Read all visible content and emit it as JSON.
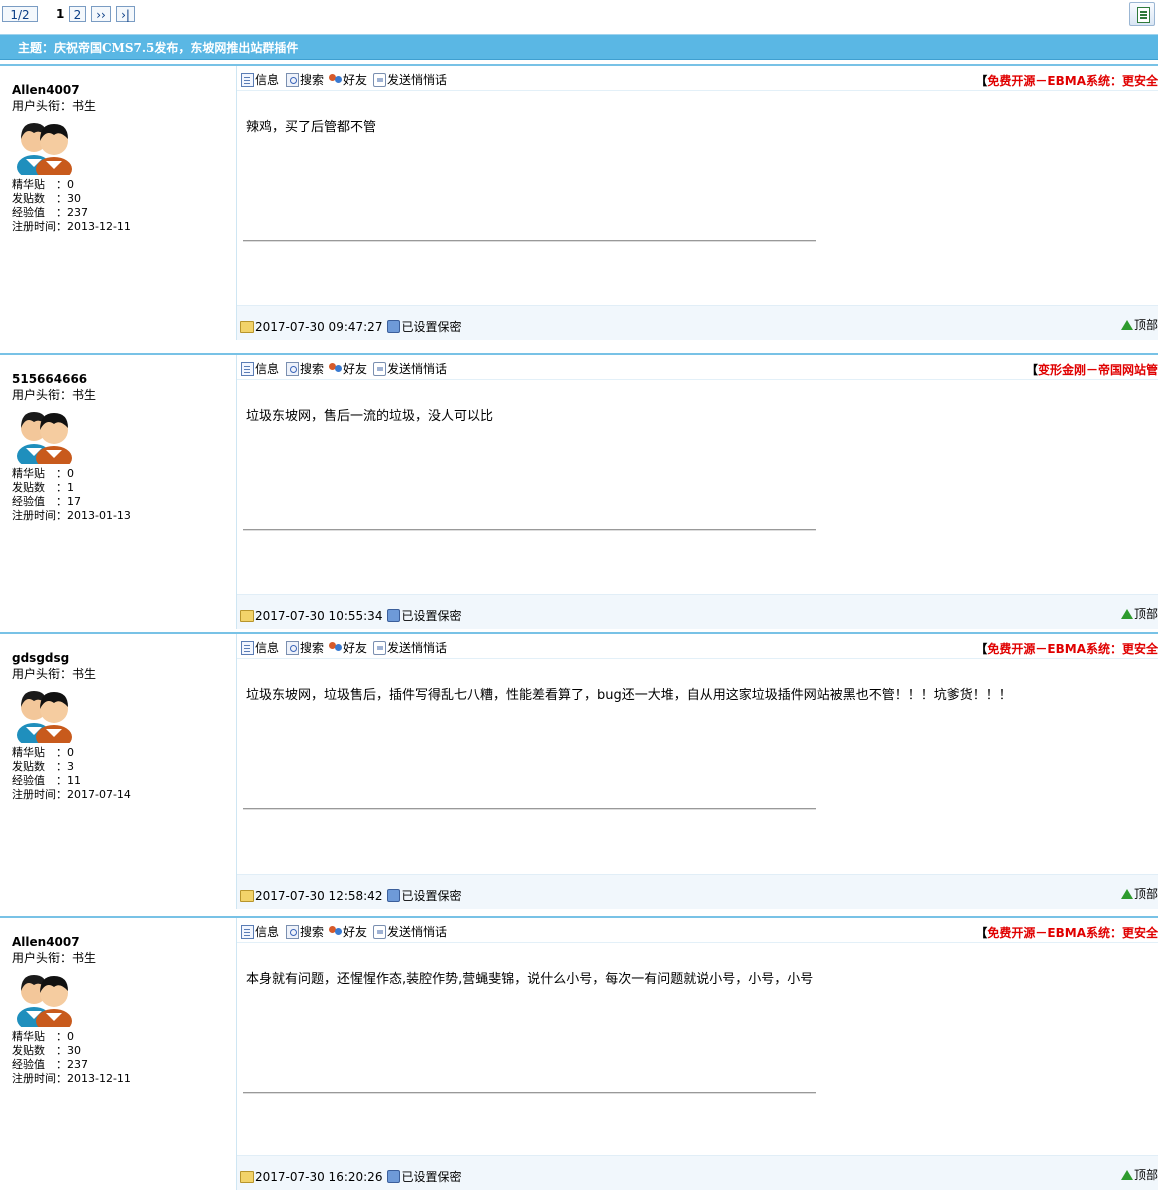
{
  "pager": {
    "page_indicator": "1/2",
    "current_page": "1",
    "next_page": "2",
    "next_symbol": "››",
    "last_symbol": "›|"
  },
  "topic": {
    "title": "主题：庆祝帝国CMS7.5发布，东坡网推出站群插件"
  },
  "labels": {
    "user_title_prefix": "用户头衔：",
    "essence": "精华贴　：",
    "posts": "发贴数　：",
    "exp": "经验值　：",
    "reg": "注册时间：",
    "info": "信息",
    "search": "搜索",
    "friend": "好友",
    "whisper": "发送悄悄话",
    "privacy": "已设置保密",
    "top": "顶部"
  },
  "posts": [
    {
      "username": "Allen4007",
      "user_title": "书生",
      "essence": "0",
      "post_count": "30",
      "exp": "237",
      "reg_date": "2013-12-11",
      "ad_text": "免费开源－EBMA系统：更安全",
      "content": "辣鸡，买了后管都不管",
      "time": "2017-07-30 09:47:27"
    },
    {
      "username": "515664666",
      "user_title": "书生",
      "essence": "0",
      "post_count": "1",
      "exp": "17",
      "reg_date": "2013-01-13",
      "ad_text": "变形金刚－帝国网站管",
      "content": "垃圾东坡网，售后一流的垃圾，没人可以比",
      "time": "2017-07-30 10:55:34"
    },
    {
      "username": "gdsgdsg",
      "user_title": "书生",
      "essence": "0",
      "post_count": "3",
      "exp": "11",
      "reg_date": "2017-07-14",
      "ad_text": "免费开源－EBMA系统：更安全",
      "content": "垃圾东坡网，垃圾售后，插件写得乱七八糟，性能差看算了，bug还一大堆，自从用这家垃圾插件网站被黑也不管！！！坑爹货！！！",
      "time": "2017-07-30 12:58:42"
    },
    {
      "username": "Allen4007",
      "user_title": "书生",
      "essence": "0",
      "post_count": "30",
      "exp": "237",
      "reg_date": "2013-12-11",
      "ad_text": "免费开源－EBMA系统：更安全",
      "content": "本身就有问题，还惺惺作态,装腔作势,营蝇斐锦，说什么小号，每次一有问题就说小号，小号，小号",
      "time": "2017-07-30 16:20:26"
    }
  ]
}
